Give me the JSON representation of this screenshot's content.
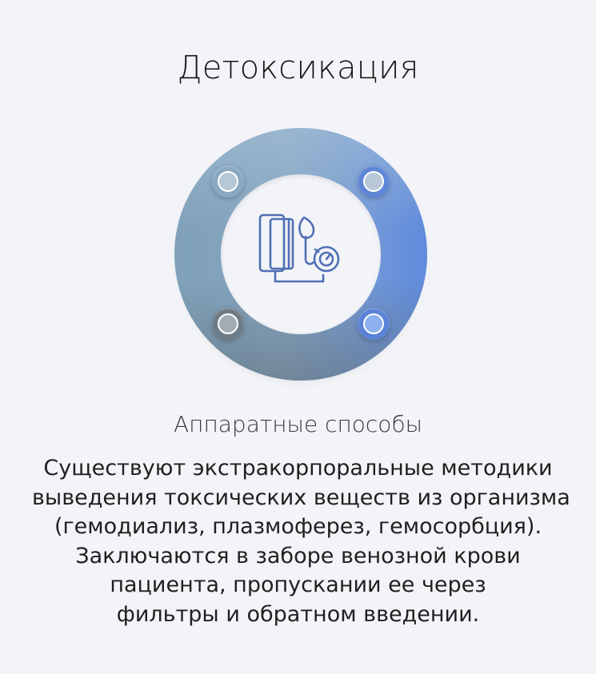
{
  "title": "Детоксикация",
  "subtitle": "Аппаратные способы",
  "description_lines": [
    "Существуют экстракорпоральные методики",
    "выведения токсических веществ из организма",
    "(гемодиализ, плазмоферез, гемосорбция).",
    "Заключаются в заборе венозной крови",
    "пациента, пропускании ее через",
    "фильтры и обратном введении."
  ],
  "center_icon": "apparatus-with-gauge-icon",
  "colors": {
    "background": "#f3f4f8",
    "ring_left": "#7fa1b8",
    "ring_right": "#5f8bdc",
    "ring_bottom": "#6d7b86",
    "icon_stroke": "#4f6fb4"
  }
}
